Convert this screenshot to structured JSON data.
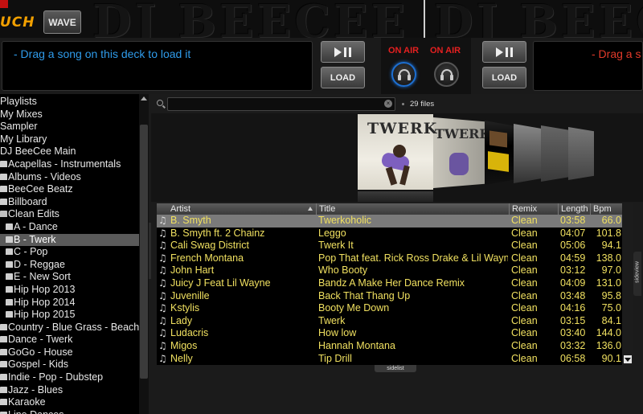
{
  "header": {
    "logo_text": "UCH",
    "wave_label": "WAVE",
    "watermark_left": "DJ BEECEE",
    "watermark_right": "DJ BEEC"
  },
  "decks": {
    "left": {
      "placeholder": "- Drag a song on this deck to load it",
      "load_label": "LOAD",
      "text_color": "#2f9bea"
    },
    "right": {
      "placeholder": "- Drag a s",
      "load_label": "LOAD",
      "text_color": "#e23a2a"
    },
    "on_air_left": "ON AIR",
    "on_air_right": "ON AIR"
  },
  "folders": {
    "tab_label": "folders",
    "items": [
      {
        "label": "Playlists",
        "icon": "none",
        "indent": 0
      },
      {
        "label": "My Mixes",
        "icon": "none",
        "indent": 0
      },
      {
        "label": "Sampler",
        "icon": "none",
        "indent": 0
      },
      {
        "label": "My Library",
        "icon": "none",
        "indent": 0
      },
      {
        "label": "DJ BeeCee Main",
        "icon": "none",
        "indent": 0
      },
      {
        "label": "Acapellas - Instrumentals",
        "icon": "folder-icon",
        "indent": 1
      },
      {
        "label": "Albums - Videos",
        "icon": "folder-icon",
        "indent": 1
      },
      {
        "label": "BeeCee Beatz",
        "icon": "folder-icon",
        "indent": 1
      },
      {
        "label": "Billboard",
        "icon": "folder-icon",
        "indent": 1
      },
      {
        "label": "Clean Edits",
        "icon": "folder-open-icon",
        "indent": 1
      },
      {
        "label": "A - Dance",
        "icon": "folder-icon",
        "indent": 2
      },
      {
        "label": "B - Twerk",
        "icon": "folder-icon",
        "indent": 2,
        "selected": true
      },
      {
        "label": "C - Pop",
        "icon": "folder-icon",
        "indent": 2
      },
      {
        "label": "D - Reggae",
        "icon": "folder-icon",
        "indent": 2
      },
      {
        "label": "E - New Sort",
        "icon": "folder-icon",
        "indent": 2
      },
      {
        "label": "Hip Hop 2013",
        "icon": "folder-icon",
        "indent": 2
      },
      {
        "label": "Hip Hop 2014",
        "icon": "folder-icon",
        "indent": 2
      },
      {
        "label": "Hip Hop 2015",
        "icon": "folder-icon",
        "indent": 2
      },
      {
        "label": "Country - Blue Grass - Beach",
        "icon": "folder-icon",
        "indent": 1
      },
      {
        "label": "Dance - Twerk",
        "icon": "folder-icon",
        "indent": 1
      },
      {
        "label": "GoGo - House",
        "icon": "folder-icon",
        "indent": 1
      },
      {
        "label": "Gospel - Kids",
        "icon": "folder-icon",
        "indent": 1
      },
      {
        "label": "Indie - Pop - Dubstep",
        "icon": "folder-icon",
        "indent": 1
      },
      {
        "label": "Jazz - Blues",
        "icon": "folder-icon",
        "indent": 1
      },
      {
        "label": "Karaoke",
        "icon": "folder-icon",
        "indent": 1
      },
      {
        "label": "Line Dances",
        "icon": "folder-icon",
        "indent": 1
      }
    ]
  },
  "search": {
    "value": "",
    "placeholder": "",
    "file_count": "29 files"
  },
  "coverflow": {
    "main_cover_title": "TWERK",
    "second_cover_title": "TWERK"
  },
  "tracklist": {
    "columns": {
      "artist": "Artist",
      "title": "Title",
      "remix": "Remix",
      "length": "Length",
      "bpm": "Bpm"
    },
    "rows": [
      {
        "artist": "B. Smyth",
        "title": "Twerkoholic",
        "remix": "Clean",
        "length": "03:58",
        "bpm": "66.0",
        "selected": true
      },
      {
        "artist": "B. Smyth ft. 2 Chainz",
        "title": "Leggo",
        "remix": "Clean",
        "length": "04:07",
        "bpm": "101.8"
      },
      {
        "artist": "Cali Swag District",
        "title": "Twerk It",
        "remix": "Clean",
        "length": "05:06",
        "bpm": "94.1"
      },
      {
        "artist": "French Montana",
        "title": "Pop That feat. Rick Ross Drake & Lil Wayne",
        "remix": "Clean",
        "length": "04:59",
        "bpm": "138.0"
      },
      {
        "artist": "John Hart",
        "title": "Who Booty",
        "remix": "Clean",
        "length": "03:12",
        "bpm": "97.0"
      },
      {
        "artist": "Juicy J Feat Lil Wayne",
        "title": "Bandz A Make Her Dance Remix",
        "remix": "Clean",
        "length": "04:09",
        "bpm": "131.0"
      },
      {
        "artist": "Juvenille",
        "title": "Back That Thang Up",
        "remix": "Clean",
        "length": "03:48",
        "bpm": "95.8"
      },
      {
        "artist": "Kstylis",
        "title": "Booty Me Down",
        "remix": "Clean",
        "length": "04:16",
        "bpm": "75.0"
      },
      {
        "artist": "Lady",
        "title": "Twerk",
        "remix": "Clean",
        "length": "03:15",
        "bpm": "84.1"
      },
      {
        "artist": "Ludacris",
        "title": "How low",
        "remix": "Clean",
        "length": "03:40",
        "bpm": "144.0"
      },
      {
        "artist": "Migos",
        "title": "Hannah Montana",
        "remix": "Clean",
        "length": "03:32",
        "bpm": "136.0"
      },
      {
        "artist": "Nelly",
        "title": "Tip Drill",
        "remix": "Clean",
        "length": "06:58",
        "bpm": "90.1"
      }
    ]
  },
  "tabs": {
    "sidelist": "sidelist",
    "sideview": "sideview"
  },
  "colors": {
    "track_text": "#f0e060",
    "deck_left_text": "#2f9bea",
    "deck_right_text": "#e23a2a",
    "on_air": "#e42020",
    "logo": "#f2a000"
  }
}
